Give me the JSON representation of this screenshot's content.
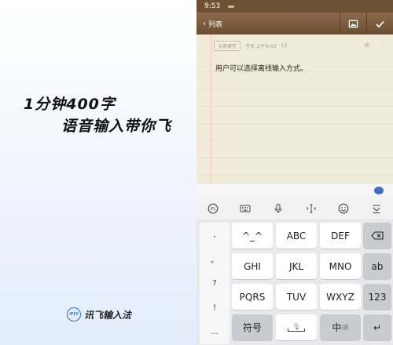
{
  "promo": {
    "line1": "1分钟400字",
    "line2": "语音输入带你飞",
    "brand_logo": "iFLY",
    "brand_name": "讯飞输入法"
  },
  "phone": {
    "status_time": "9:53",
    "back_label": "列表",
    "toolbar_icons": [
      "image-icon",
      "check-icon"
    ],
    "note": {
      "folder": "全部便签",
      "timestamp": "今天 上午9:53",
      "char_count": "13",
      "text": "用户可以选择离线输入方式。"
    }
  },
  "keyboard": {
    "toolbar_icons": [
      "logo-icon",
      "keyboard-icon",
      "mic-icon",
      "cursor-icon",
      "emoji-icon",
      "collapse-icon"
    ],
    "punctuation": [
      ",",
      "。",
      "?",
      "!",
      "..."
    ],
    "rows": [
      [
        "^_^",
        "ABC",
        "DEF"
      ],
      [
        "GHI",
        "JKL",
        "MNO"
      ],
      [
        "PQRS",
        "TUV",
        "WXYZ"
      ]
    ],
    "right_keys": [
      "⌫",
      "ab",
      "123"
    ],
    "bottom": {
      "symbols": "符号",
      "lang_main": "中",
      "lang_sub": "/英",
      "enter": "↵"
    }
  }
}
